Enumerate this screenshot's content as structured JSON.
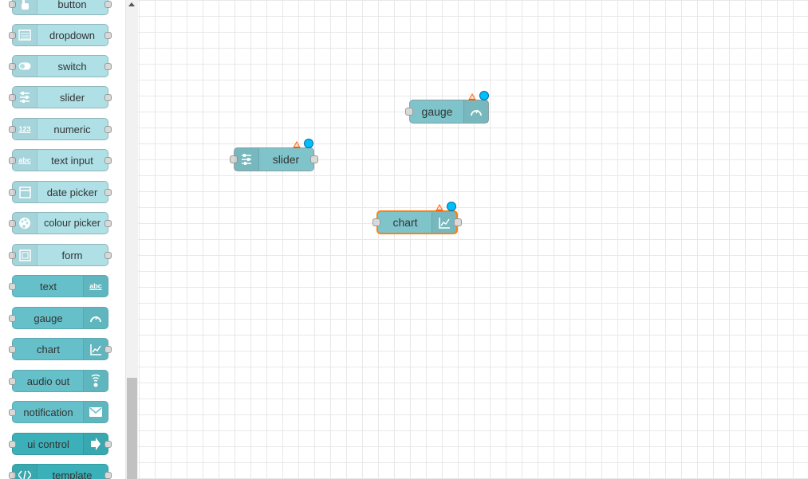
{
  "palette": {
    "nodes": [
      {
        "label": "button",
        "icon": "hand-pointer-icon"
      },
      {
        "label": "dropdown",
        "icon": "list-icon"
      },
      {
        "label": "switch",
        "icon": "toggle-icon"
      },
      {
        "label": "slider",
        "icon": "sliders-icon"
      },
      {
        "label": "numeric",
        "icon": "numeric-icon"
      },
      {
        "label": "text input",
        "icon": "text-input-icon"
      },
      {
        "label": "date picker",
        "icon": "calendar-icon"
      },
      {
        "label": "colour picker",
        "icon": "palette-icon"
      },
      {
        "label": "form",
        "icon": "form-icon"
      },
      {
        "label": "text",
        "icon": "text-icon"
      },
      {
        "label": "gauge",
        "icon": "gauge-icon"
      },
      {
        "label": "chart",
        "icon": "line-chart-icon"
      },
      {
        "label": "audio out",
        "icon": "speaker-icon"
      },
      {
        "label": "notification",
        "icon": "envelope-icon"
      },
      {
        "label": "ui control",
        "icon": "arrow-right-icon"
      },
      {
        "label": "template",
        "icon": "code-icon"
      }
    ],
    "icon_glyphs": {
      "numeric": "123",
      "text_input": "abc",
      "text": "abc"
    }
  },
  "workspace": {
    "nodes": [
      {
        "label": "gauge",
        "icon": "gauge-icon",
        "status": "warning, changed"
      },
      {
        "label": "slider",
        "icon": "sliders-icon",
        "status": "warning, changed"
      },
      {
        "label": "chart",
        "icon": "line-chart-icon",
        "status": "selected, warning, changed"
      }
    ]
  },
  "colors": {
    "palette_node_light": "#aee0e6",
    "palette_node_dark": "#66c0c9",
    "palette_node_darker": "#3bb0b8",
    "workspace_node": "#7fc4ca",
    "selection": "#ff7f0e",
    "warning": "#ff5a00",
    "changed": "#00bfff"
  }
}
